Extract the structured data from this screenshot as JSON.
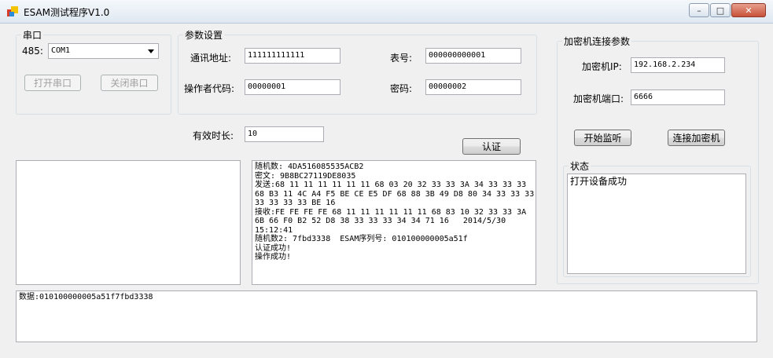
{
  "window": {
    "title": "ESAM测试程序V1.0",
    "min": "–",
    "max": "□",
    "close": "✕"
  },
  "serial": {
    "legend": "串口",
    "port_label": "485:",
    "port_value": "COM1",
    "open_button": "打开串口",
    "close_button": "关闭串口"
  },
  "params": {
    "legend": "参数设置",
    "addr_label": "通讯地址:",
    "addr_value": "111111111111",
    "meter_label": "表号:",
    "meter_value": "000000000001",
    "operator_label": "操作者代码:",
    "operator_value": "00000001",
    "password_label": "密码:",
    "password_value": "00000002"
  },
  "validity": {
    "label": "有效时长:",
    "value": "10"
  },
  "auth_button": "认证",
  "encryptor": {
    "legend": "加密机连接参数",
    "ip_label": "加密机IP:",
    "ip_value": "192.168.2.234",
    "port_label": "加密机端口:",
    "port_value": "6666",
    "listen_button": "开始监听",
    "connect_button": "连接加密机"
  },
  "status": {
    "legend": "状态",
    "text": "打开设备成功"
  },
  "left_log": "",
  "log": "随机数: 4DA516085535ACB2\n密文: 9B8BC27119DE8035\n发送:68 11 11 11 11 11 11 68 03 20 32 33 33 3A 34 33 33 33\n68 B3 11 4C A4 F5 BE CE E5 DF 68 88 3B 49 D8 80 34 33 33 33\n33 33 33 33 BE 16\n接收:FE FE FE FE 68 11 11 11 11 11 11 68 83 10 32 33 33 3A\n6B 66 F0 B2 52 D8 38 33 33 33 34 34 71 16   2014/5/30\n15:12:41\n随机数2: 7fbd3338  ESAM序列号: 010100000005a51f\n认证成功!\n操作成功!",
  "data_box": "数据:010100000005a51f7fbd3338"
}
